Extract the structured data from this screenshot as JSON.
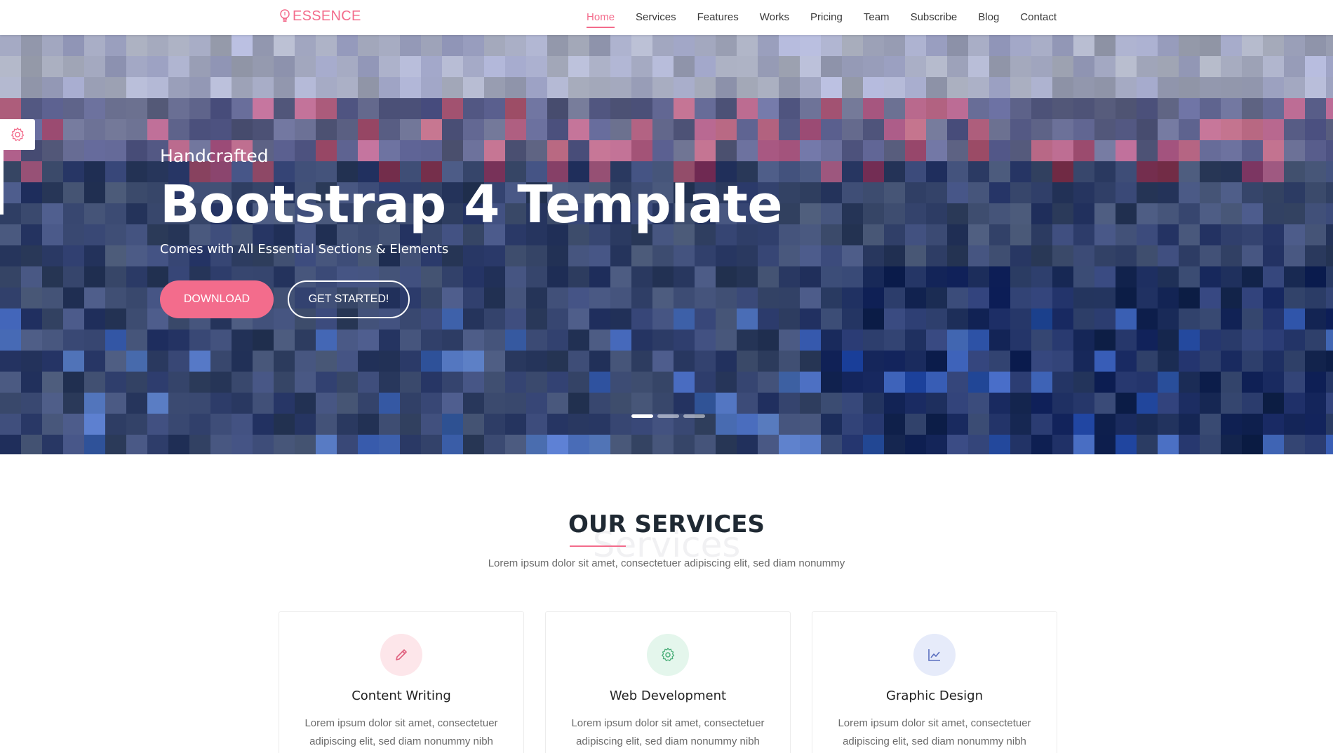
{
  "brand": {
    "name": "ESSENCE",
    "color": "#f36c8c"
  },
  "nav": {
    "items": [
      {
        "label": "Home",
        "active": true
      },
      {
        "label": "Services"
      },
      {
        "label": "Features"
      },
      {
        "label": "Works"
      },
      {
        "label": "Pricing"
      },
      {
        "label": "Team"
      },
      {
        "label": "Subscribe"
      },
      {
        "label": "Blog"
      },
      {
        "label": "Contact"
      }
    ]
  },
  "hero": {
    "subtitle": "Handcrafted",
    "title": "Bootstrap 4 Template",
    "tagline": "Comes with All Essential Sections & Elements",
    "primary_button": "DOWNLOAD",
    "secondary_button": "GET STARTED!",
    "slides": 3,
    "active_slide": 1
  },
  "services": {
    "title": "OUR SERVICES",
    "background_word": "Services",
    "description": "Lorem ipsum dolor sit amet, consectetuer adipiscing elit, sed diam nonummy",
    "cards": [
      {
        "icon": "pencil-icon",
        "title": "Content Writing",
        "text": "Lorem ipsum dolor sit amet, consectetuer adipiscing elit, sed diam nonummy nibh",
        "icon_bg": "#fde6ea",
        "icon_color": "#e0607e"
      },
      {
        "icon": "gear-icon",
        "title": "Web Development",
        "text": "Lorem ipsum dolor sit amet, consectetuer adipiscing elit, sed diam nonummy nibh",
        "icon_bg": "#e4f6ec",
        "icon_color": "#4caf7a"
      },
      {
        "icon": "chart-icon",
        "title": "Graphic Design",
        "text": "Lorem ipsum dolor sit amet, consectetuer adipiscing elit, sed diam nonummy nibh",
        "icon_bg": "#e6ebfa",
        "icon_color": "#5b6fbf"
      }
    ]
  },
  "colors": {
    "accent": "#f36c8c",
    "heading": "#1f2933",
    "muted": "#6b6b6b"
  }
}
